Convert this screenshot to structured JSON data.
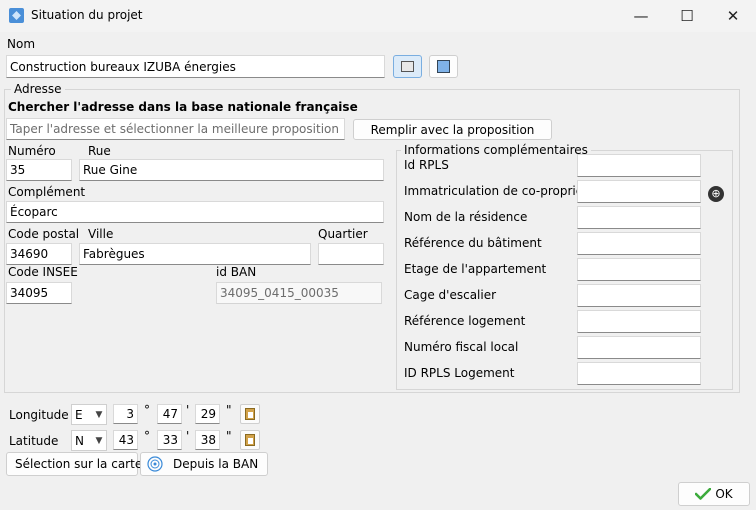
{
  "window": {
    "title": "Situation du projet",
    "minimize": "—",
    "maximize": "☐",
    "close": "✕"
  },
  "nom": {
    "label": "Nom",
    "value": "Construction bureaux IZUBA énergies"
  },
  "adresse": {
    "legend": "Adresse",
    "search_heading": "Chercher l'adresse dans la base nationale française",
    "search_placeholder": "Taper l'adresse et sélectionner la meilleure proposition",
    "fill_button": "Remplir avec la proposition",
    "numero_label": "Numéro",
    "numero_value": "35",
    "rue_label": "Rue",
    "rue_value": "Rue Gine",
    "complement_label": "Complément",
    "complement_value": "Écoparc",
    "code_postal_label": "Code postal",
    "code_postal_value": "34690",
    "ville_label": "Ville",
    "ville_value": "Fabrègues",
    "quartier_label": "Quartier",
    "quartier_value": "",
    "code_insee_label": "Code INSEE",
    "code_insee_value": "34095",
    "id_ban_label": "id BAN",
    "id_ban_value": "34095_0415_00035"
  },
  "infos": {
    "legend": "Informations complémentaires",
    "fields": [
      {
        "label": "Id RPLS",
        "value": ""
      },
      {
        "label": "Immatriculation de co-propriété",
        "value": ""
      },
      {
        "label": "Nom de la résidence",
        "value": ""
      },
      {
        "label": "Référence du bâtiment",
        "value": ""
      },
      {
        "label": "Etage de l'appartement",
        "value": ""
      },
      {
        "label": "Cage d'escalier",
        "value": ""
      },
      {
        "label": "Référence logement",
        "value": ""
      },
      {
        "label": "Numéro fiscal local",
        "value": ""
      },
      {
        "label": "ID RPLS Logement",
        "value": ""
      }
    ]
  },
  "coords": {
    "longitude": {
      "label": "Longitude",
      "dir": "E",
      "deg": "3",
      "min": "47",
      "sec": "29"
    },
    "latitude": {
      "label": "Latitude",
      "dir": "N",
      "deg": "43",
      "min": "33",
      "sec": "38"
    },
    "deg_unit": "°",
    "min_unit": "'",
    "sec_unit": "\""
  },
  "buttons": {
    "map": "Sélection sur la carte",
    "ban": "Depuis la BAN",
    "ok": "OK"
  },
  "colors": {
    "accent": "#0067c0",
    "ok_check": "#3cab3c"
  }
}
